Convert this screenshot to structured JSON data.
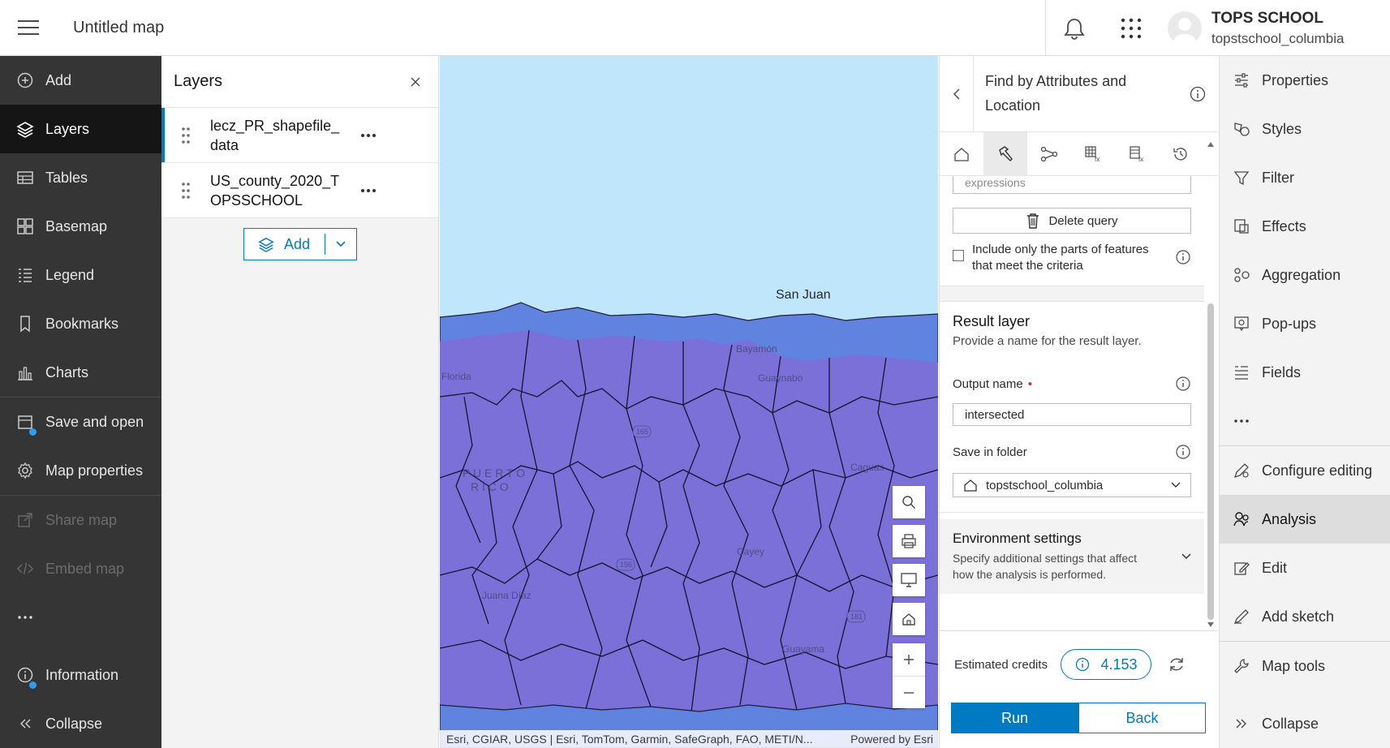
{
  "header": {
    "map_title": "Untitled map",
    "user_name": "TOPS SCHOOL",
    "user_id": "topstschool_columbia"
  },
  "left_nav": {
    "items": [
      {
        "label": "Add",
        "icon": "plus-circle-icon",
        "state": "normal"
      },
      {
        "label": "Layers",
        "icon": "layers-icon",
        "state": "active"
      },
      {
        "label": "Tables",
        "icon": "table-icon",
        "state": "normal"
      },
      {
        "label": "Basemap",
        "icon": "basemap-icon",
        "state": "normal"
      },
      {
        "label": "Legend",
        "icon": "legend-icon",
        "state": "normal"
      },
      {
        "label": "Bookmarks",
        "icon": "bookmark-icon",
        "state": "normal"
      },
      {
        "label": "Charts",
        "icon": "chart-icon",
        "state": "normal"
      },
      {
        "label": "Save and open",
        "icon": "save-icon",
        "state": "normal"
      },
      {
        "label": "Map properties",
        "icon": "gear-icon",
        "state": "normal"
      },
      {
        "label": "Share map",
        "icon": "share-icon",
        "state": "disabled"
      },
      {
        "label": "Embed map",
        "icon": "code-icon",
        "state": "disabled"
      },
      {
        "label": "...",
        "icon": "more-icon",
        "state": "normal"
      },
      {
        "label": "Information",
        "icon": "info-icon",
        "state": "normal"
      },
      {
        "label": "Collapse",
        "icon": "collapse-icon",
        "state": "normal"
      }
    ]
  },
  "layers_panel": {
    "title": "Layers",
    "layers": [
      {
        "name": "lecz_PR_shapefile_data",
        "selected": true
      },
      {
        "name": "US_county_2020_TOPSSCHOOL",
        "selected": false
      }
    ],
    "add_label": "Add"
  },
  "map": {
    "labels": {
      "san_juan": "San Juan",
      "florida": "Florida",
      "guaynabo": "Guaynabo",
      "puerto": "P U E R T O",
      "rico": "R I C O",
      "caguas": "Caguas",
      "cayey": "Cayey",
      "juana_diaz": "Juana Díaz",
      "guayama": "Guayama",
      "bayamon": "Bayamón",
      "hwy_165": "165",
      "hwy_156": "156",
      "hwy_181": "181"
    },
    "attribution_left": "Esri, CGIAR, USGS | Esri, TomTom, Garmin, SafeGraph, FAO, METI/N...",
    "attribution_right": "Powered by Esri",
    "colors": {
      "water": "#bfe6fa",
      "land": "#7b6fd8",
      "coast_band": "#5f83de"
    }
  },
  "tool_panel": {
    "title": "Find by Attributes and Location",
    "expressions_text": "expressions",
    "delete_query_label": "Delete query",
    "include_parts_label": "Include only the parts of features that meet the criteria",
    "result_layer": {
      "title": "Result layer",
      "subtitle": "Provide a name for the result layer.",
      "output_name_label": "Output name",
      "output_name_value": "intersected",
      "save_folder_label": "Save in folder",
      "save_folder_value": "topstschool_columbia"
    },
    "environment": {
      "title": "Environment settings",
      "subtitle": "Specify additional settings that affect how the analysis is performed."
    },
    "credits_label": "Estimated credits",
    "credits_value": "4.153",
    "run_label": "Run",
    "back_label": "Back"
  },
  "right_nav": {
    "items": [
      {
        "label": "Properties",
        "icon": "sliders-icon",
        "state": "normal"
      },
      {
        "label": "Styles",
        "icon": "styles-icon",
        "state": "normal"
      },
      {
        "label": "Filter",
        "icon": "filter-icon",
        "state": "normal"
      },
      {
        "label": "Effects",
        "icon": "effects-icon",
        "state": "normal"
      },
      {
        "label": "Aggregation",
        "icon": "aggregation-icon",
        "state": "normal"
      },
      {
        "label": "Pop-ups",
        "icon": "popup-icon",
        "state": "normal"
      },
      {
        "label": "Fields",
        "icon": "fields-icon",
        "state": "normal"
      },
      {
        "label": "...",
        "icon": "more-icon",
        "state": "normal"
      },
      {
        "label": "Configure editing",
        "icon": "configure-editing-icon",
        "state": "normal"
      },
      {
        "label": "Analysis",
        "icon": "analysis-icon",
        "state": "active"
      },
      {
        "label": "Edit",
        "icon": "edit-icon",
        "state": "normal"
      },
      {
        "label": "Add sketch",
        "icon": "sketch-icon",
        "state": "normal"
      },
      {
        "label": "Map tools",
        "icon": "wrench-icon",
        "state": "normal"
      },
      {
        "label": "Collapse",
        "icon": "collapse-icon",
        "state": "normal"
      }
    ]
  }
}
